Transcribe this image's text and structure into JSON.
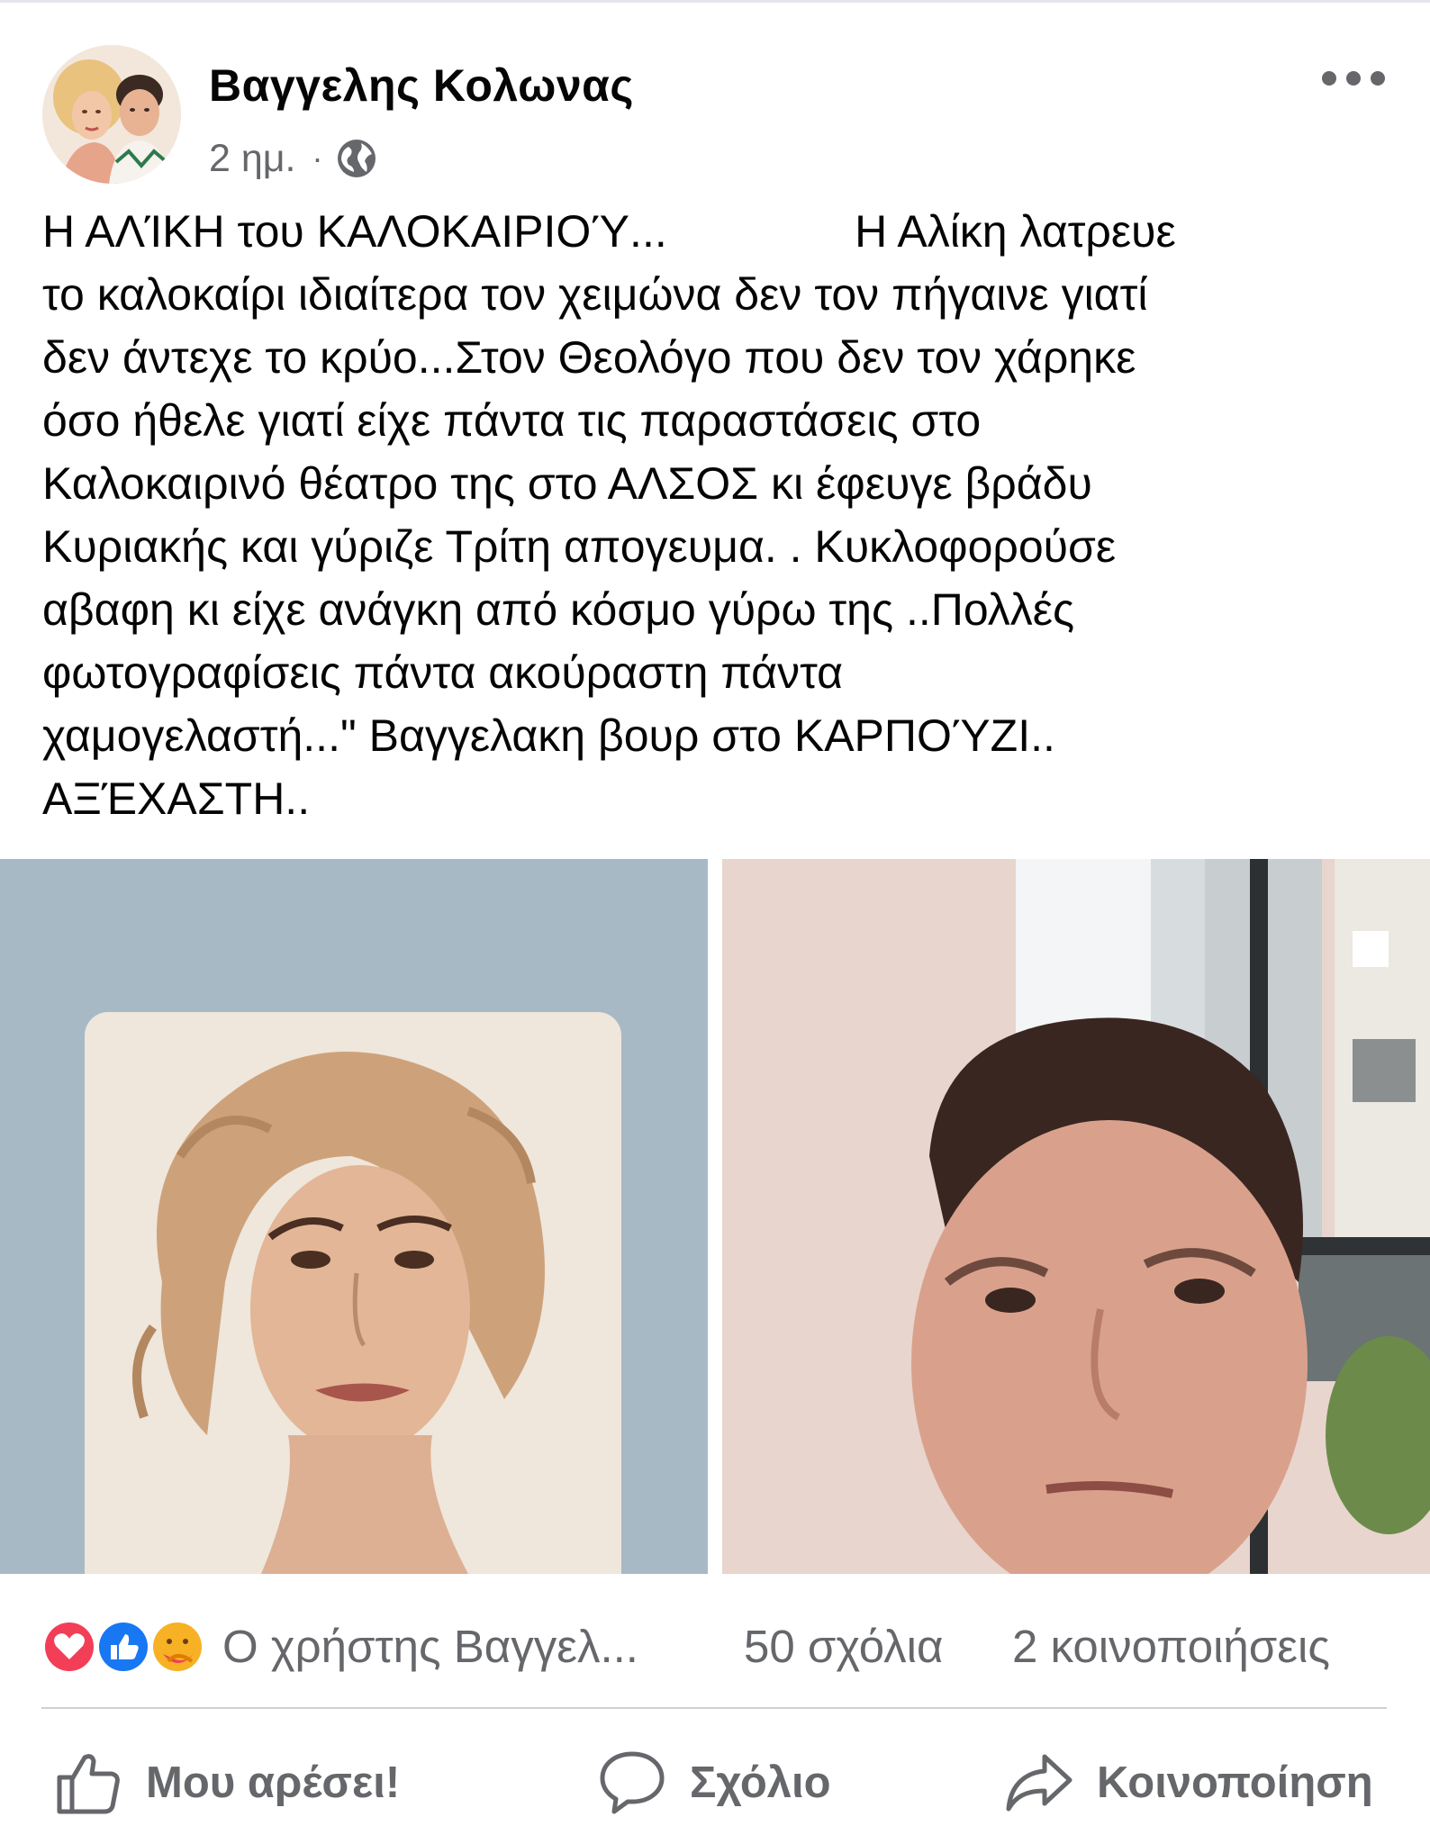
{
  "post": {
    "author": "Βαγγελης Κολωνας",
    "time": "2 ημ.",
    "separator": "·",
    "privacy_icon": "globe-icon",
    "more_icon": "more-icon",
    "text_lines": [
      "Η ΑΛΊΚΗ του ΚΑΛΟΚΑΙΡΙΟΎ...               Η Αλίκη λατρευε",
      "το καλοκαίρι ιδιαίτερα τον χειμώνα δεν τον πήγαινε γιατί",
      "δεν άντεχε το κρύο...Στον Θεολόγο που δεν τον χάρηκε",
      "όσο ήθελε γιατί είχε πάντα τις παραστάσεις στο",
      "Καλοκαιρινό θέατρο της στο ΑΛΣΟΣ κι έφευγε βράδυ",
      "Κυριακής και γύριζε Τρίτη απογευμα. . Κυκλοφορούσε",
      "αβαφη κι είχε ανάγκη από κόσμο γύρω της ..Πολλές",
      "φωτογραφίσεις πάντα ακούραστη πάντα",
      "χαμογελαστή...\" Βαγγελακη βουρ στο ΚΑΡΠΟΎΖΙ..",
      "ΑΞΈΧΑΣΤΗ.."
    ]
  },
  "photos": [
    {
      "name": "vintage-portrait-photo",
      "background": "#a8b9c6"
    },
    {
      "name": "selfie-photo",
      "background": "#e8d5ce"
    }
  ],
  "stats": {
    "reactions": [
      "love",
      "like",
      "care"
    ],
    "reaction_summary": "Ο χρήστης Βαγγελ...",
    "comments": "50 σχόλια",
    "shares": "2 κοινοποιήσεις"
  },
  "actions": {
    "like": "Μου αρέσει!",
    "comment": "Σχόλιο",
    "share": "Κοινοποίηση"
  },
  "colors": {
    "secondary_text": "#65676b",
    "like_blue": "#1877f2",
    "love_red": "#f33e58",
    "care_yellow": "#f7b125"
  }
}
